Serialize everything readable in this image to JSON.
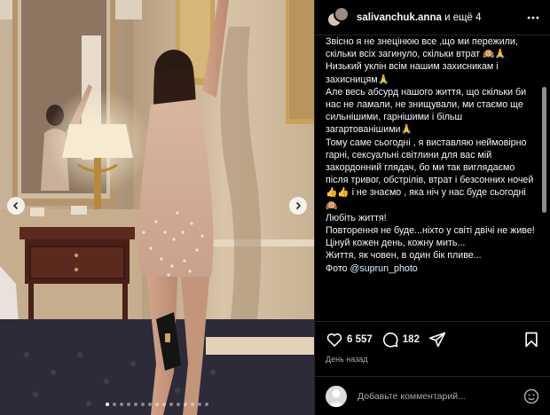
{
  "header": {
    "username": "salivanchuk.anna",
    "collab_suffix": " и ещё 4"
  },
  "caption": {
    "lines": [
      "Звісно я не знецінюю все ,що ми пережили, скільки всіх загинуло, скільки втрат 🙉🙏",
      "Низький уклін всім нашим захисникам і захисницям🙏",
      "Але весь абсурд нашого життя, що скільки би нас не ламали, не знищували, ми стаємо ще сильнішими, гарнішими і більш загартованішими🙏",
      "Тому саме сьогодні , я виставляю неймовірно гарні, сексуальні світлини для вас мій закордонний глядач, бо ми так виглядаємо після тривог, обстрілів, втрат і безсонних ночей👍👍 і не знаємо , яка ніч у нас буде сьогодні🙉",
      "Любіть життя!",
      "Повторення не буде...ніхто у світі двічі не живе!",
      "Цінуй кожен день, кожну мить...",
      "Життя, як човен, в один бік пливе...",
      "Фото "
    ],
    "mention": "@suprun_photo"
  },
  "actions": {
    "likes": "6 557",
    "comments": "182",
    "icons": [
      "heart-icon",
      "comment-icon",
      "share-icon",
      "bookmark-icon"
    ]
  },
  "timestamp": "День назад",
  "comment_box": {
    "placeholder": "Добавьте комментарий..."
  },
  "carousel": {
    "dot_count": 15,
    "active_index": 0
  },
  "colors": {
    "panel_bg": "#000000",
    "text": "#f5f5f5",
    "muted": "#a8a8a8",
    "divider": "#262626"
  }
}
